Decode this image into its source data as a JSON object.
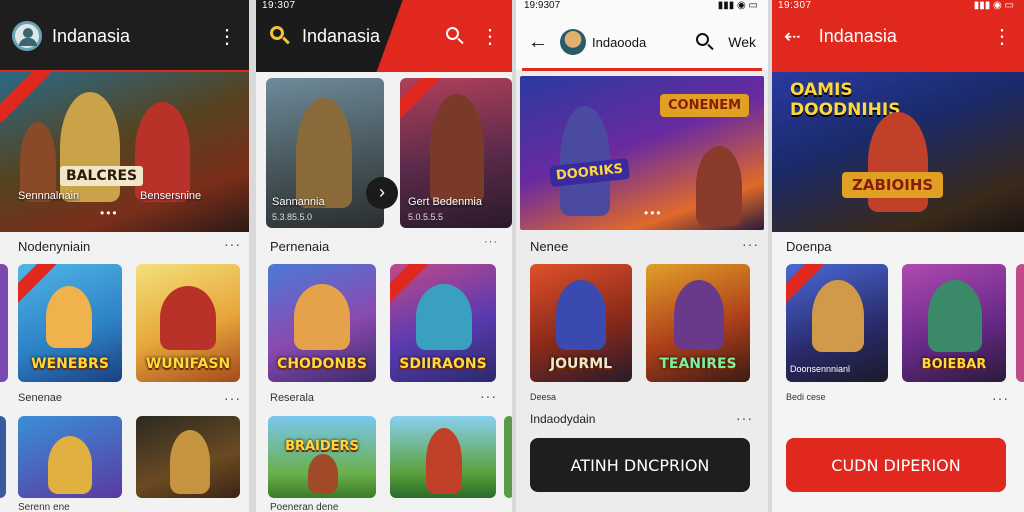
{
  "colors": {
    "brand_red": "#e0281f",
    "dark": "#202020",
    "light": "#f2f2f2"
  },
  "panel1": {
    "title": "Indanasia",
    "hero_title": "Sennnalnain",
    "hero_title2": "Bensersnine",
    "hero_banner": "BALCRES",
    "section1": "Nodenyniain",
    "tile1": "WENEBRS",
    "tile2": "WUNIFASN",
    "caption1": "Senenae",
    "section2_caption": "Serenn ene"
  },
  "panel2": {
    "status_time": "19:307",
    "title": "Indanasia",
    "hero_title": "Sannannia",
    "hero_sub": "5.3.85.5.0",
    "hero_title2": "Gert Bedenmia",
    "hero_sub2": "5.0.5.5.5",
    "section1": "Pernenaia",
    "tile1": "CHODONBS",
    "tile2": "SDIIRAONS",
    "caption1": "Reserala",
    "tile3": "BRAIDERS",
    "section2_caption": "Poeneran dene"
  },
  "panel3": {
    "status_time": "19:9307",
    "title": "Indaooda",
    "action": "Wek",
    "hero_banner": "CONENEM",
    "hero_banner2": "DOORIKS",
    "section1": "Nenee",
    "tile1": "JOURML",
    "tile2": "TEANIRES",
    "caption1": "Deesa",
    "section2": "Indaodydain",
    "cta": "ATINH DNCPRION"
  },
  "panel4": {
    "status_time": "19:307",
    "title": "Indanasia",
    "hero_line1": "OAMIS",
    "hero_line2": "DOODNIHIS",
    "hero_banner": "ZABIOIHS",
    "section1": "Doenpa",
    "caption1": "Doonsennnianl",
    "tile2": "BOIEBAR",
    "caption2": "Bedi cese",
    "cta": "CUDN DIPERION"
  }
}
